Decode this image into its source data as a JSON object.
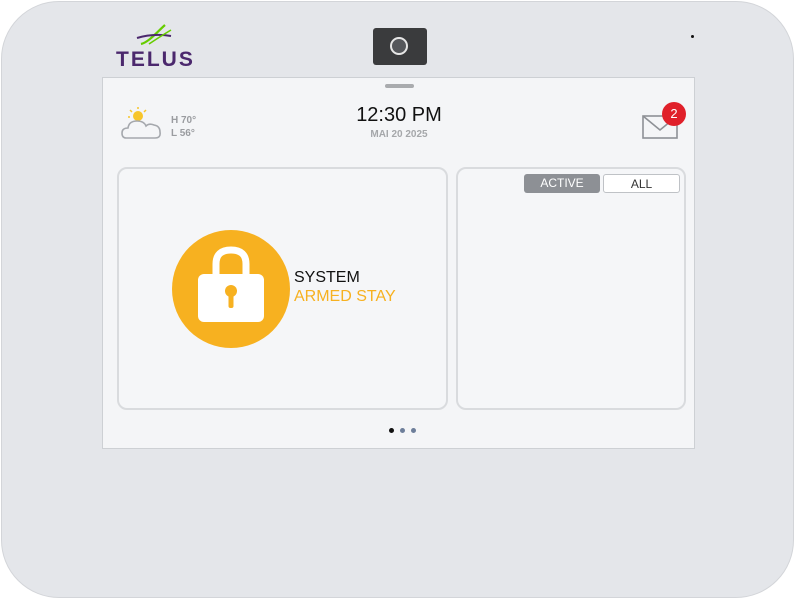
{
  "device": {
    "brand": "TELUS",
    "colors": {
      "brand": "#4b286d",
      "brand_accent": "#66cc00",
      "frame": "#e4e6ea"
    }
  },
  "header": {
    "weather": {
      "icon": "partly-sunny-icon",
      "high": "H 70°",
      "low": "L 56°"
    },
    "time": "12:30 PM",
    "date": "MAI 20 2025",
    "messages": {
      "icon": "envelope-icon",
      "count": "2",
      "badge_color": "#e0202a"
    }
  },
  "security": {
    "icon": "lock-icon",
    "title": "SYSTEM",
    "state": "ARMED STAY",
    "state_color": "#f7b120"
  },
  "events_panel": {
    "tabs": [
      {
        "label": "ACTIVE",
        "selected": true
      },
      {
        "label": "ALL",
        "selected": false
      }
    ]
  },
  "pager": {
    "page_count": 3,
    "current_page": 1
  }
}
